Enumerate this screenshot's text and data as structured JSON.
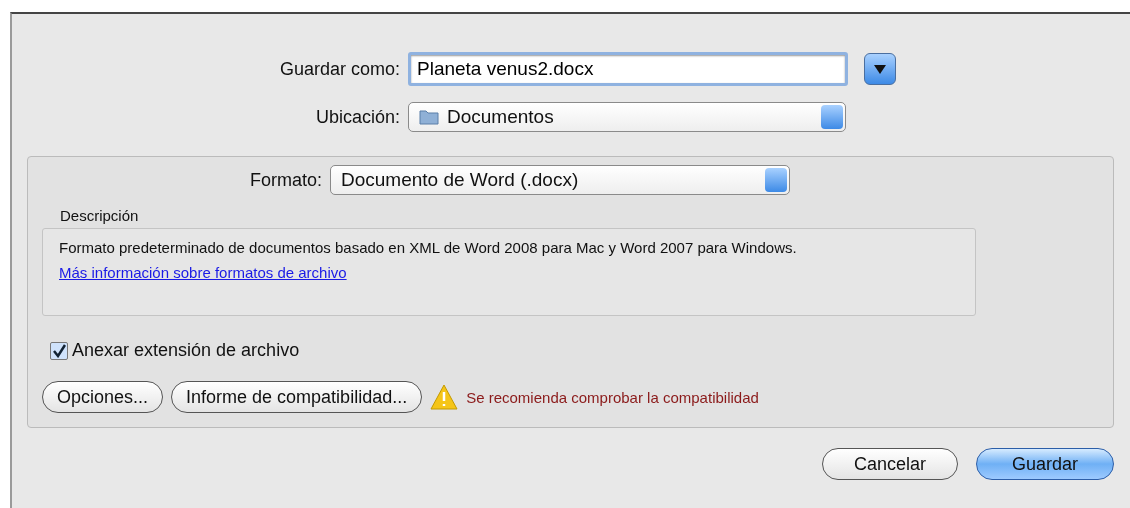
{
  "save_as": {
    "label": "Guardar como:",
    "value": "Planeta venus2.docx"
  },
  "location": {
    "label": "Ubicación:",
    "value": "Documentos"
  },
  "format": {
    "label": "Formato:",
    "value": "Documento de Word (.docx)"
  },
  "description": {
    "title": "Descripción",
    "text": "Formato predeterminado de documentos basado en XML de Word 2008  para Mac y Word 2007 para Windows.",
    "link": "Más información sobre formatos de archivo"
  },
  "append_extension": {
    "label": "Anexar extensión de archivo",
    "checked": true
  },
  "options_buttons": [
    "Opciones...",
    "Informe de compatibilidad..."
  ],
  "warning": "Se recomienda comprobar la compatibilidad",
  "buttons": [
    {
      "label": "Cancelar",
      "kind": "normal"
    },
    {
      "label": "Guardar",
      "kind": "default"
    }
  ]
}
